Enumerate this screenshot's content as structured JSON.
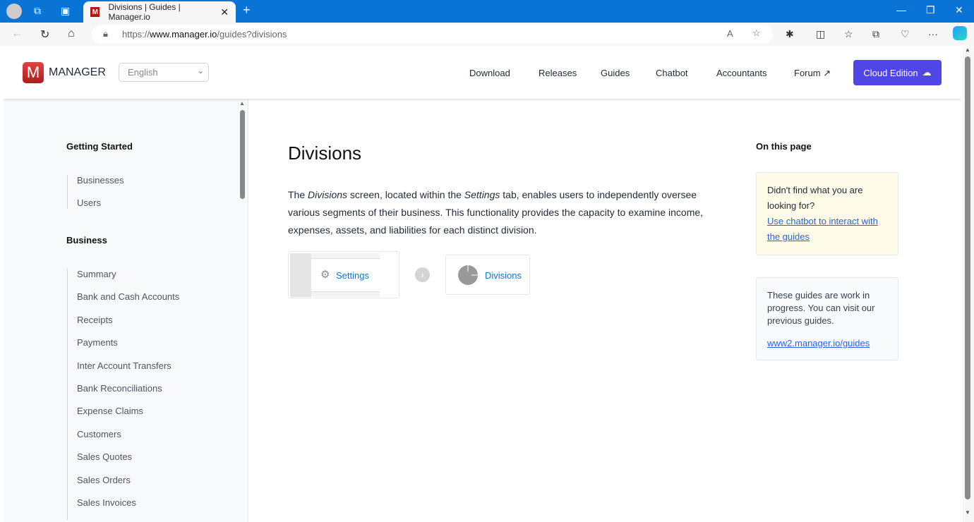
{
  "browser": {
    "tab_title": "Divisions | Guides | Manager.io",
    "url_prefix": "https://",
    "url_domain": "www.manager.io",
    "url_path": "/guides?divisions",
    "favicon_letter": "M"
  },
  "header": {
    "logo_letter": "M",
    "brand": "MANAGER",
    "language": "English",
    "nav": [
      "Download",
      "Releases",
      "Guides",
      "Chatbot",
      "Accountants",
      "Forum"
    ],
    "cloud_button": "Cloud Edition",
    "accent": "#4f46e5"
  },
  "sidebar": {
    "sections": [
      {
        "title": "Getting Started",
        "items": [
          "Businesses",
          "Users"
        ]
      },
      {
        "title": "Business",
        "items": [
          "Summary",
          "Bank and Cash Accounts",
          "Receipts",
          "Payments",
          "Inter Account Transfers",
          "Bank Reconciliations",
          "Expense Claims",
          "Customers",
          "Sales Quotes",
          "Sales Orders",
          "Sales Invoices"
        ]
      }
    ]
  },
  "main": {
    "title": "Divisions",
    "intro": {
      "p1": "The ",
      "em1": "Divisions",
      "p2": " screen, located within the ",
      "em2": "Settings",
      "p3": " tab, enables users to independently oversee various segments of their business. This functionality provides the capacity to examine income, expenses, assets, and liabilities for each distinct division."
    },
    "breadcrumb": {
      "step1": "Settings",
      "step2": "Divisions"
    }
  },
  "aside": {
    "title": "On this page",
    "help_text": "Didn't find what you are looking for?",
    "help_link": "Use chatbot to interact with the guides",
    "wip_text": "These guides are work in progress. You can visit our previous guides.",
    "wip_link": "www2.manager.io/guides"
  }
}
